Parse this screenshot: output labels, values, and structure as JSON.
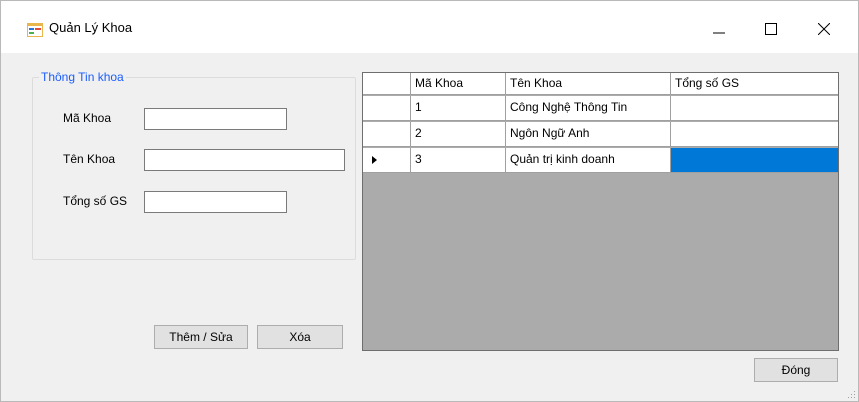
{
  "window": {
    "title": "Quản Lý Khoa",
    "icon": "form-icon",
    "controls": [
      "minimize-icon",
      "maximize-icon",
      "close-icon"
    ]
  },
  "groupbox": {
    "legend": "Thông Tin khoa",
    "fields": {
      "ma_khoa": {
        "label": "Mã Khoa",
        "value": ""
      },
      "ten_khoa": {
        "label": "Tên Khoa",
        "value": ""
      },
      "tong_so_gs": {
        "label": "Tổng số GS",
        "value": ""
      }
    }
  },
  "buttons": {
    "them_sua": "Thêm / Sửa",
    "xoa": "Xóa",
    "dong": "Đóng"
  },
  "grid": {
    "columns": [
      "Mã Khoa",
      "Tên Khoa",
      "Tổng số GS"
    ],
    "rows": [
      {
        "ma": "1",
        "ten": "Công Nghệ Thông Tin",
        "tong": ""
      },
      {
        "ma": "2",
        "ten": "Ngôn Ngữ Anh",
        "tong": ""
      },
      {
        "ma": "3",
        "ten": "Quản trị kinh doanh",
        "tong": ""
      }
    ],
    "current_row_indicator": "row-3",
    "selection_color": "#0078d7"
  },
  "colors": {
    "legend_text": "#1a5cff",
    "window_bg": "#f0f0f0",
    "grid_bg": "#ababab"
  }
}
